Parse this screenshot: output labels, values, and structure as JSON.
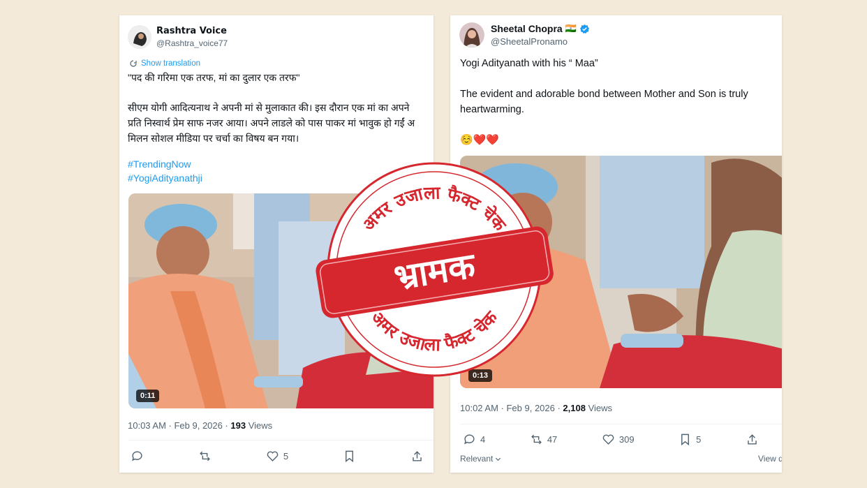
{
  "left_tweet": {
    "name": "Rashtra Voice",
    "handle": "@Rashtra_voice77",
    "show_translation": "Show translation",
    "line1": "\"पद की गरिमा एक तरफ, मां का दुलार एक तरफ\"",
    "para": [
      "सीएम योगी आदित्यनाथ ने अपनी मां से मुलाकात की। इस दौरान एक मां का अपने",
      "प्रति निस्वार्थ प्रेम साफ नजर आया। अपने लाडले को पास पाकर मां भावुक हो गईं अ",
      "मिलन सोशल मीडिया पर चर्चा का विषय बन गया।"
    ],
    "hashtags": [
      "#TrendingNow",
      "#YogiAdityanathji"
    ],
    "video_time": "0:11",
    "timestamp": "10:03 AM · Feb 9, 2026 · ",
    "views_count": "193",
    "views_label": " Views",
    "like_count": "5"
  },
  "right_tweet": {
    "name": "Sheetal Chopra",
    "flag": "🇮🇳",
    "handle": "@SheetalPronamo",
    "line1": "Yogi Adityanath with his “ Maa”",
    "line2": "The evident and adorable bond between Mother and Son is truly",
    "line3": "heartwarming.",
    "emojis": "☺️❤️❤️",
    "video_time": "0:13",
    "timestamp": "10:02 AM · Feb 9, 2026 · ",
    "views_count": "2,108",
    "views_label": " Views",
    "reply_count": "4",
    "retweet_count": "47",
    "like_count": "309",
    "bookmark_count": "5",
    "relevant_label": "Relevant",
    "view_label": "View q"
  },
  "stamp": {
    "top_arc": "अमर उजाला फैक्ट चेक",
    "bottom_arc": "अमर उजाला फैक्ट चेक",
    "verdict": "भ्रामक",
    "color": "#d6262e"
  },
  "colors": {
    "background": "#f3ead9",
    "link": "#1d9bf0",
    "secondary_text": "#536471"
  }
}
